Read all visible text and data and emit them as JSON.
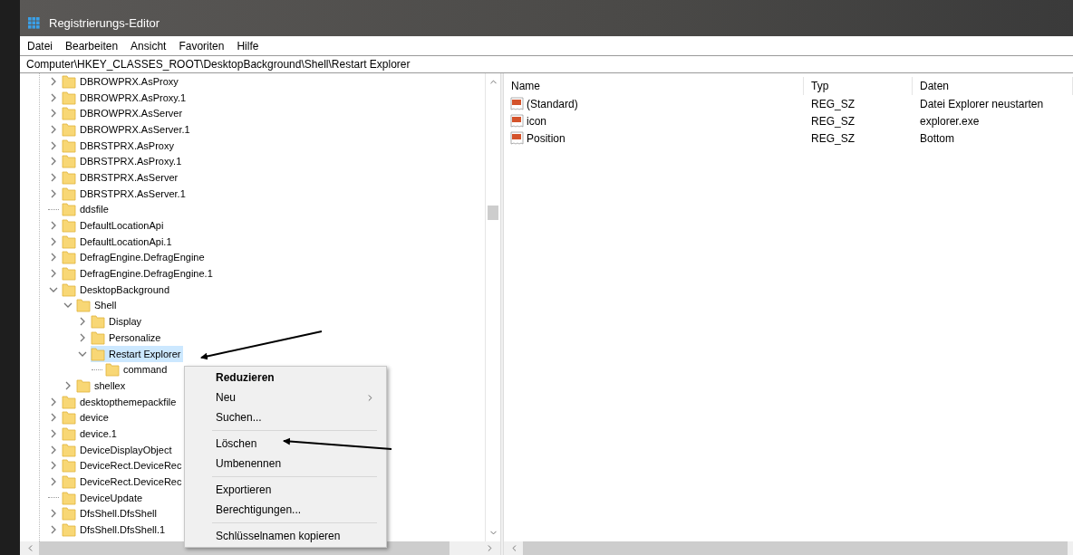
{
  "window": {
    "title": "Registrierungs-Editor"
  },
  "menu_bar": [
    "Datei",
    "Bearbeiten",
    "Ansicht",
    "Favoriten",
    "Hilfe"
  ],
  "address": "Computer\\HKEY_CLASSES_ROOT\\DesktopBackground\\Shell\\Restart Explorer",
  "tree": {
    "items": [
      {
        "kind": "node",
        "label": "DBROWPRX.AsProxy",
        "expanded": false,
        "selected": false
      },
      {
        "kind": "node",
        "label": "DBROWPRX.AsProxy.1",
        "expanded": false,
        "selected": false
      },
      {
        "kind": "node",
        "label": "DBROWPRX.AsServer",
        "expanded": false,
        "selected": false
      },
      {
        "kind": "node",
        "label": "DBROWPRX.AsServer.1",
        "expanded": false,
        "selected": false
      },
      {
        "kind": "node",
        "label": "DBRSTPRX.AsProxy",
        "expanded": false,
        "selected": false
      },
      {
        "kind": "node",
        "label": "DBRSTPRX.AsProxy.1",
        "expanded": false,
        "selected": false
      },
      {
        "kind": "node",
        "label": "DBRSTPRX.AsServer",
        "expanded": false,
        "selected": false
      },
      {
        "kind": "node",
        "label": "DBRSTPRX.AsServer.1",
        "expanded": false,
        "selected": false
      },
      {
        "kind": "leaf",
        "label": "ddsfile",
        "selected": false
      },
      {
        "kind": "node",
        "label": "DefaultLocationApi",
        "expanded": false,
        "selected": false
      },
      {
        "kind": "node",
        "label": "DefaultLocationApi.1",
        "expanded": false,
        "selected": false
      },
      {
        "kind": "node",
        "label": "DefragEngine.DefragEngine",
        "expanded": false,
        "selected": false
      },
      {
        "kind": "node",
        "label": "DefragEngine.DefragEngine.1",
        "expanded": false,
        "selected": false
      },
      {
        "kind": "node",
        "label": "DesktopBackground",
        "expanded": true,
        "selected": false,
        "children": [
          {
            "kind": "node",
            "label": "Shell",
            "expanded": true,
            "selected": false,
            "children": [
              {
                "kind": "node",
                "label": "Display",
                "expanded": false,
                "selected": false
              },
              {
                "kind": "node",
                "label": "Personalize",
                "expanded": false,
                "selected": false
              },
              {
                "kind": "node",
                "label": "Restart Explorer",
                "expanded": true,
                "selected": true,
                "children": [
                  {
                    "kind": "leaf",
                    "label": "command",
                    "selected": false
                  }
                ]
              }
            ]
          },
          {
            "kind": "node",
            "label": "shellex",
            "expanded": false,
            "selected": false
          }
        ]
      },
      {
        "kind": "node",
        "label": "desktopthemepackfile",
        "expanded": false,
        "selected": false
      },
      {
        "kind": "node",
        "label": "device",
        "expanded": false,
        "selected": false
      },
      {
        "kind": "node",
        "label": "device.1",
        "expanded": false,
        "selected": false
      },
      {
        "kind": "node",
        "label": "DeviceDisplayObject",
        "expanded": false,
        "selected": false
      },
      {
        "kind": "node",
        "label": "DeviceRect.DeviceRec",
        "expanded": false,
        "selected": false
      },
      {
        "kind": "node",
        "label": "DeviceRect.DeviceRec",
        "expanded": false,
        "selected": false
      },
      {
        "kind": "leaf",
        "label": "DeviceUpdate",
        "selected": false
      },
      {
        "kind": "node",
        "label": "DfsShell.DfsShell",
        "expanded": false,
        "selected": false
      },
      {
        "kind": "node",
        "label": "DfsShell.DfsShell.1",
        "expanded": false,
        "selected": false
      }
    ]
  },
  "values": {
    "columns": [
      "Name",
      "Typ",
      "Daten"
    ],
    "rows": [
      {
        "name": "(Standard)",
        "type": "REG_SZ",
        "data": "Datei Explorer neustarten"
      },
      {
        "name": "icon",
        "type": "REG_SZ",
        "data": "explorer.exe"
      },
      {
        "name": "Position",
        "type": "REG_SZ",
        "data": "Bottom"
      }
    ]
  },
  "context_menu": [
    {
      "kind": "item",
      "label": "Reduzieren",
      "bold": true,
      "submenu": false
    },
    {
      "kind": "item",
      "label": "Neu",
      "bold": false,
      "submenu": true
    },
    {
      "kind": "item",
      "label": "Suchen...",
      "bold": false,
      "submenu": false
    },
    {
      "kind": "separator"
    },
    {
      "kind": "item",
      "label": "Löschen",
      "bold": false,
      "submenu": false
    },
    {
      "kind": "item",
      "label": "Umbenennen",
      "bold": false,
      "submenu": false
    },
    {
      "kind": "separator"
    },
    {
      "kind": "item",
      "label": "Exportieren",
      "bold": false,
      "submenu": false
    },
    {
      "kind": "item",
      "label": "Berechtigungen...",
      "bold": false,
      "submenu": false
    },
    {
      "kind": "separator"
    },
    {
      "kind": "item",
      "label": "Schlüsselnamen kopieren",
      "bold": false,
      "submenu": false
    }
  ]
}
